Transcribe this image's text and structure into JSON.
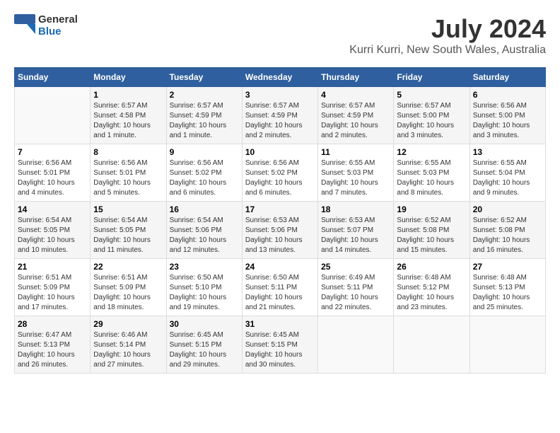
{
  "logo": {
    "line1": "General",
    "line2": "Blue"
  },
  "title": "July 2024",
  "subtitle": "Kurri Kurri, New South Wales, Australia",
  "days_of_week": [
    "Sunday",
    "Monday",
    "Tuesday",
    "Wednesday",
    "Thursday",
    "Friday",
    "Saturday"
  ],
  "weeks": [
    [
      {
        "day": "",
        "info": ""
      },
      {
        "day": "1",
        "info": "Sunrise: 6:57 AM\nSunset: 4:58 PM\nDaylight: 10 hours\nand 1 minute."
      },
      {
        "day": "2",
        "info": "Sunrise: 6:57 AM\nSunset: 4:59 PM\nDaylight: 10 hours\nand 1 minute."
      },
      {
        "day": "3",
        "info": "Sunrise: 6:57 AM\nSunset: 4:59 PM\nDaylight: 10 hours\nand 2 minutes."
      },
      {
        "day": "4",
        "info": "Sunrise: 6:57 AM\nSunset: 4:59 PM\nDaylight: 10 hours\nand 2 minutes."
      },
      {
        "day": "5",
        "info": "Sunrise: 6:57 AM\nSunset: 5:00 PM\nDaylight: 10 hours\nand 3 minutes."
      },
      {
        "day": "6",
        "info": "Sunrise: 6:56 AM\nSunset: 5:00 PM\nDaylight: 10 hours\nand 3 minutes."
      }
    ],
    [
      {
        "day": "7",
        "info": "Sunrise: 6:56 AM\nSunset: 5:01 PM\nDaylight: 10 hours\nand 4 minutes."
      },
      {
        "day": "8",
        "info": "Sunrise: 6:56 AM\nSunset: 5:01 PM\nDaylight: 10 hours\nand 5 minutes."
      },
      {
        "day": "9",
        "info": "Sunrise: 6:56 AM\nSunset: 5:02 PM\nDaylight: 10 hours\nand 6 minutes."
      },
      {
        "day": "10",
        "info": "Sunrise: 6:56 AM\nSunset: 5:02 PM\nDaylight: 10 hours\nand 6 minutes."
      },
      {
        "day": "11",
        "info": "Sunrise: 6:55 AM\nSunset: 5:03 PM\nDaylight: 10 hours\nand 7 minutes."
      },
      {
        "day": "12",
        "info": "Sunrise: 6:55 AM\nSunset: 5:03 PM\nDaylight: 10 hours\nand 8 minutes."
      },
      {
        "day": "13",
        "info": "Sunrise: 6:55 AM\nSunset: 5:04 PM\nDaylight: 10 hours\nand 9 minutes."
      }
    ],
    [
      {
        "day": "14",
        "info": "Sunrise: 6:54 AM\nSunset: 5:05 PM\nDaylight: 10 hours\nand 10 minutes."
      },
      {
        "day": "15",
        "info": "Sunrise: 6:54 AM\nSunset: 5:05 PM\nDaylight: 10 hours\nand 11 minutes."
      },
      {
        "day": "16",
        "info": "Sunrise: 6:54 AM\nSunset: 5:06 PM\nDaylight: 10 hours\nand 12 minutes."
      },
      {
        "day": "17",
        "info": "Sunrise: 6:53 AM\nSunset: 5:06 PM\nDaylight: 10 hours\nand 13 minutes."
      },
      {
        "day": "18",
        "info": "Sunrise: 6:53 AM\nSunset: 5:07 PM\nDaylight: 10 hours\nand 14 minutes."
      },
      {
        "day": "19",
        "info": "Sunrise: 6:52 AM\nSunset: 5:08 PM\nDaylight: 10 hours\nand 15 minutes."
      },
      {
        "day": "20",
        "info": "Sunrise: 6:52 AM\nSunset: 5:08 PM\nDaylight: 10 hours\nand 16 minutes."
      }
    ],
    [
      {
        "day": "21",
        "info": "Sunrise: 6:51 AM\nSunset: 5:09 PM\nDaylight: 10 hours\nand 17 minutes."
      },
      {
        "day": "22",
        "info": "Sunrise: 6:51 AM\nSunset: 5:09 PM\nDaylight: 10 hours\nand 18 minutes."
      },
      {
        "day": "23",
        "info": "Sunrise: 6:50 AM\nSunset: 5:10 PM\nDaylight: 10 hours\nand 19 minutes."
      },
      {
        "day": "24",
        "info": "Sunrise: 6:50 AM\nSunset: 5:11 PM\nDaylight: 10 hours\nand 21 minutes."
      },
      {
        "day": "25",
        "info": "Sunrise: 6:49 AM\nSunset: 5:11 PM\nDaylight: 10 hours\nand 22 minutes."
      },
      {
        "day": "26",
        "info": "Sunrise: 6:48 AM\nSunset: 5:12 PM\nDaylight: 10 hours\nand 23 minutes."
      },
      {
        "day": "27",
        "info": "Sunrise: 6:48 AM\nSunset: 5:13 PM\nDaylight: 10 hours\nand 25 minutes."
      }
    ],
    [
      {
        "day": "28",
        "info": "Sunrise: 6:47 AM\nSunset: 5:13 PM\nDaylight: 10 hours\nand 26 minutes."
      },
      {
        "day": "29",
        "info": "Sunrise: 6:46 AM\nSunset: 5:14 PM\nDaylight: 10 hours\nand 27 minutes."
      },
      {
        "day": "30",
        "info": "Sunrise: 6:45 AM\nSunset: 5:15 PM\nDaylight: 10 hours\nand 29 minutes."
      },
      {
        "day": "31",
        "info": "Sunrise: 6:45 AM\nSunset: 5:15 PM\nDaylight: 10 hours\nand 30 minutes."
      },
      {
        "day": "",
        "info": ""
      },
      {
        "day": "",
        "info": ""
      },
      {
        "day": "",
        "info": ""
      }
    ]
  ]
}
